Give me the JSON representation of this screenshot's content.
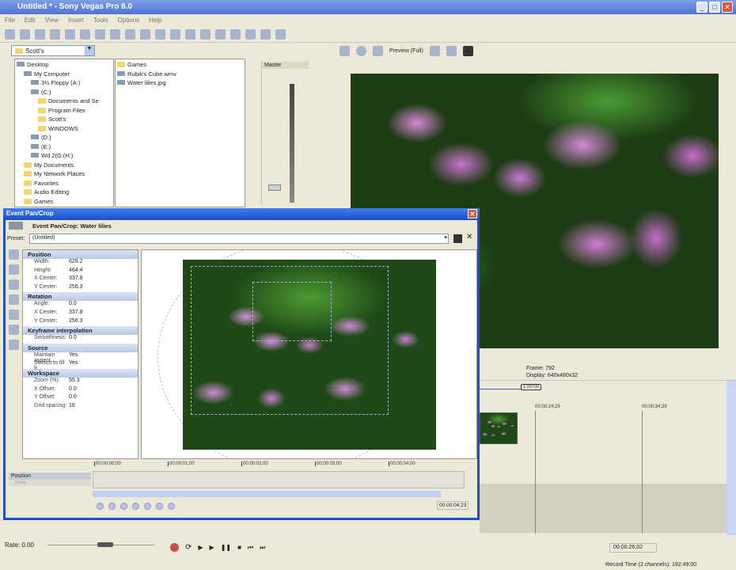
{
  "app": {
    "title": "Untitled * - Sony Vegas Pro 8.0"
  },
  "menu": [
    "File",
    "Edit",
    "View",
    "Insert",
    "Tools",
    "Options",
    "Help"
  ],
  "explorer": {
    "location": "Scott's",
    "tree": [
      {
        "label": "Desktop",
        "level": 0,
        "icon": "desktop"
      },
      {
        "label": "My Computer",
        "level": 1,
        "icon": "computer"
      },
      {
        "label": "3½ Floppy (A:)",
        "level": 2,
        "icon": "drive"
      },
      {
        "label": "(C:)",
        "level": 2,
        "icon": "drive"
      },
      {
        "label": "Documents and Se",
        "level": 3,
        "icon": "folder"
      },
      {
        "label": "Program Files",
        "level": 3,
        "icon": "folder"
      },
      {
        "label": "Scott's",
        "level": 3,
        "icon": "folder"
      },
      {
        "label": "WINDOWS",
        "level": 3,
        "icon": "folder"
      },
      {
        "label": "(D:)",
        "level": 2,
        "icon": "drive"
      },
      {
        "label": "(E:)",
        "level": 2,
        "icon": "drive"
      },
      {
        "label": "Wd 2(G:(H:)",
        "level": 2,
        "icon": "drive"
      },
      {
        "label": "My Documents",
        "level": 1,
        "icon": "folder"
      },
      {
        "label": "My Network Places",
        "level": 1,
        "icon": "folder"
      },
      {
        "label": "Favorites",
        "level": 1,
        "icon": "folder"
      },
      {
        "label": "Audio Editing",
        "level": 1,
        "icon": "folder"
      },
      {
        "label": "Games",
        "level": 1,
        "icon": "folder"
      }
    ],
    "files": [
      "Games",
      "Rubik's Cube.wmv",
      "Water lilies.jpg"
    ]
  },
  "mixer": {
    "label": "Master"
  },
  "preview": {
    "quality": "Preview (Full)",
    "frame_label": "Frame:",
    "frame": "792",
    "display_label": "Display:",
    "display": "640x480x32"
  },
  "timeline": {
    "marker": "1:00:00",
    "ticks": [
      "00:00:24;29",
      "00:00:34;29"
    ],
    "cursor_time": "00:00:26;02",
    "record_time": "Record Time (2 channels): 192:49:00"
  },
  "dialog": {
    "title": "Event Pan/Crop",
    "header": "Event Pan/Crop: Water lilies",
    "preset_label": "Preset:",
    "preset": "(Untitled)",
    "sections": [
      {
        "name": "Position",
        "rows": [
          [
            "Width:",
            "629.2"
          ],
          [
            "Height:",
            "464.4"
          ],
          [
            "X Center:",
            "337.8"
          ],
          [
            "Y Center:",
            "256.3"
          ]
        ]
      },
      {
        "name": "Rotation",
        "rows": [
          [
            "Angle:",
            "0.0"
          ],
          [
            "X Center:",
            "337.8"
          ],
          [
            "Y Center:",
            "256.3"
          ]
        ]
      },
      {
        "name": "Keyframe interpolation",
        "rows": [
          [
            "Smoothness:",
            "0.0"
          ]
        ]
      },
      {
        "name": "Source",
        "rows": [
          [
            "Maintain aspect...",
            "Yes"
          ],
          [
            "Stretch to fill fr...",
            "Yes"
          ]
        ]
      },
      {
        "name": "Workspace",
        "rows": [
          [
            "Zoom (%):",
            "55.3"
          ],
          [
            "X Offset:",
            "0.0"
          ],
          [
            "Y Offset:",
            "0.0"
          ],
          [
            "Grid spacing:",
            "16"
          ]
        ]
      }
    ],
    "track_label": "Position",
    "track_sub": "Mask",
    "ruler": [
      "00:00:00;00",
      "00:00:01;00",
      "00:00:02;00",
      "00:00:03;00",
      "00:00:04;00"
    ],
    "time": "00:00:04;23"
  },
  "transport": {
    "rate": "Rate: 0.00"
  }
}
